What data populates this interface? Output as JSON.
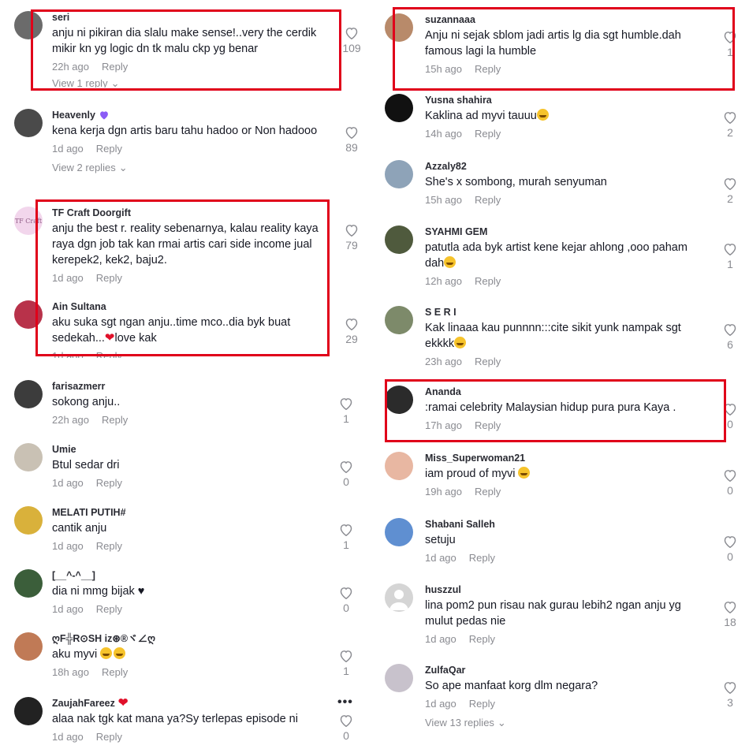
{
  "left_comments": [
    {
      "username": "seri",
      "text": "anju ni pikiran dia slalu make sense!..very the cerdik mikir kn yg logic dn tk malu ckp yg benar",
      "time": "22h ago",
      "reply": "Reply",
      "likes": "109",
      "view_replies": "View 1 reply",
      "avatar_color": "#6b6b6b"
    },
    {
      "username": "Heavenly",
      "text": "kena kerja dgn artis baru tahu hadoo or Non hadooo",
      "time": "1d ago",
      "reply": "Reply",
      "likes": "89",
      "view_replies": "View 2 replies",
      "avatar_color": "#4a4a4a"
    },
    {
      "username": "TF Craft Doorgift",
      "text": "anju the best r. reality sebenarnya, kalau reality kaya raya dgn job tak kan rmai artis cari side income jual kerepek2, kek2, baju2.",
      "time": "1d ago",
      "reply": "Reply",
      "likes": "79",
      "avatar_color": "#f2d6ec",
      "avatar_text": "TF Craft"
    },
    {
      "username": "Ain Sultana",
      "text": "aku suka sgt ngan anju..time mco..dia byk buat sedekah...",
      "text_suffix": "love kak",
      "time": "1d ago",
      "reply": "Reply",
      "likes": "29",
      "avatar_color": "#b8324a"
    },
    {
      "username": "farisazmerr",
      "text": "sokong anju..",
      "time": "22h ago",
      "reply": "Reply",
      "likes": "1",
      "avatar_color": "#3c3c3c"
    },
    {
      "username": "Umie",
      "text": "Btul sedar dri",
      "time": "1d ago",
      "reply": "Reply",
      "likes": "0",
      "avatar_color": "#c9c1b4"
    },
    {
      "username": "MELATI PUTIH#",
      "text": "cantik anju",
      "time": "1d ago",
      "reply": "Reply",
      "likes": "1",
      "avatar_color": "#d9b13b"
    },
    {
      "username": "[__^-^__]",
      "text": "dia ni mmg bijak ♥",
      "time": "1d ago",
      "reply": "Reply",
      "likes": "0",
      "avatar_color": "#3b5e3a"
    },
    {
      "username": "ღF╬R⊙SH iz⊛®ヾ∠ღ",
      "text": "aku myvi",
      "time": "18h ago",
      "reply": "Reply",
      "likes": "1",
      "avatar_color": "#c07a56"
    },
    {
      "username": "ZaujahFareez",
      "text": "alaa nak tgk kat mana ya?Sy terlepas episode ni",
      "time": "1d ago",
      "reply": "Reply",
      "likes": "0",
      "avatar_color": "#222222"
    }
  ],
  "right_comments": [
    {
      "username": "suzannaaa",
      "text": "Anju ni sejak sblom jadi artis lg dia sgt humble.dah famous lagi la humble",
      "time": "15h ago",
      "reply": "Reply",
      "likes": "1",
      "avatar_color": "#b88a6a"
    },
    {
      "username": "Yusna shahira",
      "text": "Kaklina ad myvi tauuu",
      "time": "14h ago",
      "reply": "Reply",
      "likes": "2",
      "avatar_color": "#111111"
    },
    {
      "username": "Azzaly82",
      "text": "She's x sombong, murah senyuman",
      "time": "15h ago",
      "reply": "Reply",
      "likes": "2",
      "avatar_color": "#8ea3b8"
    },
    {
      "username": "SYAHMI GEM",
      "text": "patutla ada byk artist kene kejar ahlong ,ooo paham dah",
      "time": "12h ago",
      "reply": "Reply",
      "likes": "1",
      "avatar_color": "#4f5a3d"
    },
    {
      "username": "S E R I",
      "text": "Kak linaaa kau punnnn:::cite sikit yunk nampak sgt ekkkk",
      "time": "23h ago",
      "reply": "Reply",
      "likes": "6",
      "avatar_color": "#7d8a6a"
    },
    {
      "username": "Ananda",
      "text": ":ramai celebrity Malaysian hidup pura pura Kaya .",
      "time": "17h ago",
      "reply": "Reply",
      "likes": "0",
      "avatar_color": "#2b2b2b"
    },
    {
      "username": "Miss_Superwoman21",
      "text": "iam proud of myvi",
      "time": "19h ago",
      "reply": "Reply",
      "likes": "0",
      "avatar_color": "#e8b7a2"
    },
    {
      "username": "Shabani Salleh",
      "text": "setuju",
      "time": "1d ago",
      "reply": "Reply",
      "likes": "0",
      "avatar_color": "#5f8fd1"
    },
    {
      "username": "huszzul",
      "text": "lina pom2 pun risau nak gurau lebih2 ngan anju yg mulut pedas nie",
      "time": "1d ago",
      "reply": "Reply",
      "likes": "18",
      "avatar_color": "#d5d5d5"
    },
    {
      "username": "ZulfaQar",
      "text": "So ape manfaat korg dlm negara?",
      "time": "1d ago",
      "reply": "Reply",
      "likes": "3",
      "avatar_color": "#c8c2cc",
      "view_replies": "View 13 replies"
    }
  ],
  "colors": {
    "highlight": "#e0001a",
    "muted": "#8a8b91",
    "text": "#161823"
  }
}
